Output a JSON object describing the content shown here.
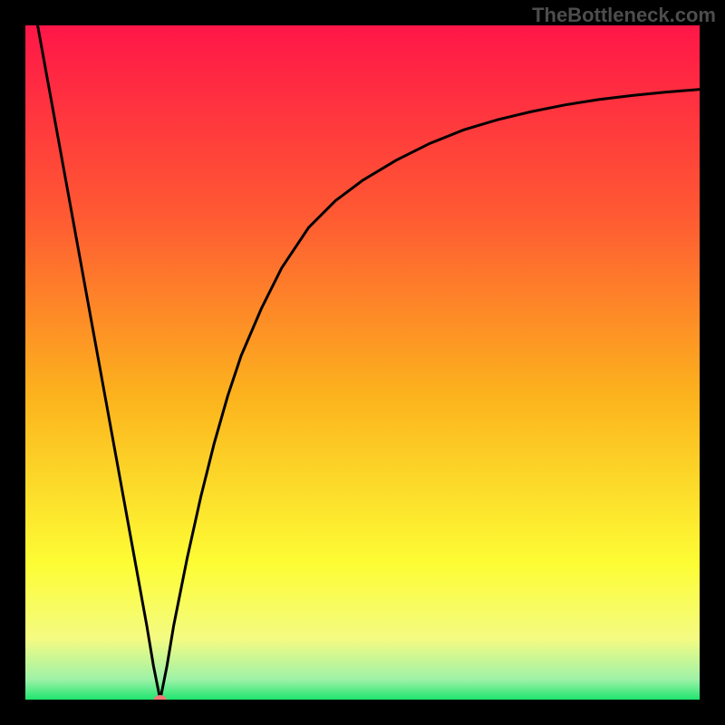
{
  "chart_data": {
    "type": "line",
    "title": "",
    "xlabel": "",
    "ylabel": "",
    "xlim": [
      0,
      100
    ],
    "ylim": [
      0,
      100
    ],
    "grid": false,
    "legend": false,
    "annotations": {
      "watermark": "TheBottleneck.com"
    },
    "background": {
      "type": "gradient-vertical",
      "stops": [
        {
          "pos": 0,
          "color": "#ff1648"
        },
        {
          "pos": 28,
          "color": "#ff5933"
        },
        {
          "pos": 55,
          "color": "#fcb31d"
        },
        {
          "pos": 80,
          "color": "#fdfd35"
        },
        {
          "pos": 91,
          "color": "#f4fb82"
        },
        {
          "pos": 97,
          "color": "#9ef2a7"
        },
        {
          "pos": 100,
          "color": "#1fe56e"
        }
      ]
    },
    "series": [
      {
        "name": "bottleneck-curve",
        "color": "#000000",
        "x": [
          0,
          2,
          4,
          6,
          8,
          10,
          12,
          14,
          16,
          18,
          19,
          20,
          21,
          22,
          24,
          26,
          28,
          30,
          32,
          35,
          38,
          42,
          46,
          50,
          55,
          60,
          65,
          70,
          75,
          80,
          85,
          90,
          95,
          100
        ],
        "y": [
          110,
          99,
          88,
          77,
          66,
          55,
          44,
          33,
          22,
          11,
          5,
          0,
          5,
          11,
          21,
          30,
          38,
          45,
          51,
          58,
          64,
          70,
          74,
          77,
          80,
          82.5,
          84.5,
          86,
          87.2,
          88.2,
          89,
          89.6,
          90.1,
          90.5
        ]
      }
    ],
    "markers": [
      {
        "name": "min-point",
        "x": 20,
        "y": 0,
        "color": "#f07878",
        "size": 10
      }
    ]
  },
  "attribution": "TheBottleneck.com"
}
